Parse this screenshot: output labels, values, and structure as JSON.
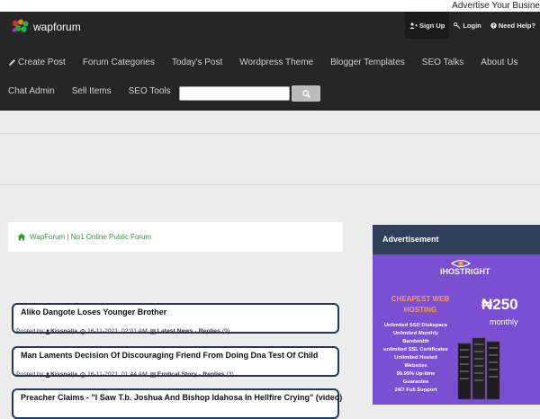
{
  "top_strip": {
    "text": "Advertise Your Busine"
  },
  "header": {
    "logo_text": "wapforum",
    "top_links": [
      "Sign Up",
      "Login",
      "Need Help?"
    ],
    "nav_row1": [
      "Create Post",
      "Forum Categories",
      "Today's Post",
      "Wordpress Theme",
      "Blogger Templates",
      "SEO Talks",
      "About Us"
    ],
    "nav_row2": [
      "Chat Admin",
      "Sell Items",
      "SEO Tools"
    ],
    "search": {
      "value": "",
      "placeholder": ""
    }
  },
  "breadcrumb": {
    "text": "WapForum | No1 Online Public Forum"
  },
  "posts": [
    {
      "title": "Aliko Dangote Loses Younger Brother",
      "posted_by_label": "Posted by: ",
      "author": "Kissnaija",
      "date": "16-11-2021, 02:01 AM",
      "category": "Latest News",
      "replies_label": "Replies",
      "replies": "(9)"
    },
    {
      "title": "Man Laments Decision Of Discouraging Friend From Doing Dna Test Of Child",
      "posted_by_label": "Posted by: ",
      "author": "Kissnaija",
      "date": "16-11-2021, 01:44 AM",
      "category": "Erotical Story",
      "replies_label": "Replies",
      "replies": "(3)"
    },
    {
      "title": "Preacher Claims - \"I Saw T.b. Joshua And Bishop Idahosa In Hellfire Crying\" (video)"
    }
  ],
  "sidebar": {
    "heading": "Advertisement",
    "ad": {
      "brand": "iHOSTRIGHT",
      "headline_1": "CHEAPEST WEB",
      "headline_2": "HOSTING",
      "price": "₦250",
      "period": "monthly",
      "features": [
        "Unlimited SSD Diskspace",
        "Unlimited Monthly",
        "Bandwidth",
        "unlimited SSL Certificates",
        "Unlimited Hosted",
        "Websites",
        "99.99% Up-time",
        "Guarantee",
        "24/7 Full Support"
      ]
    }
  },
  "colors": {
    "header_bg": "#262626",
    "accent_green": "#2e9e3e",
    "post_border": "#1f3a5f",
    "sidebar_head_bg": "#2f3f5a",
    "ad_bg": "#7a4fd2",
    "ad_orange": "#ff9a4a"
  },
  "icons": [
    "wapforum-logo-icon",
    "user-plus-icon",
    "key-icon",
    "question-icon",
    "pencil-icon",
    "search-icon",
    "home-icon",
    "user-icon",
    "clock-icon",
    "list-icon",
    "eye-icon",
    "server-icon"
  ]
}
